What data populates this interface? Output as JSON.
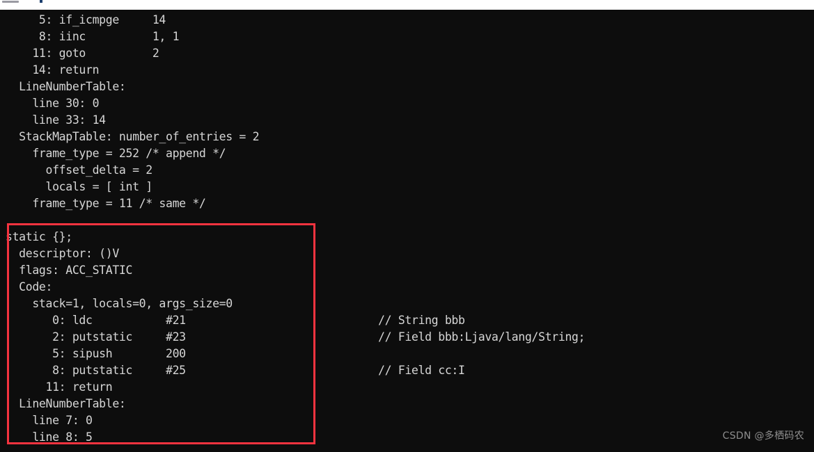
{
  "window": {
    "top_strip": {
      "menu_glyph": "menu-bar",
      "accent_mark": "accent-mark"
    }
  },
  "terminal": {
    "background_color": "#0d0d0d",
    "text_color": "#d6d6d6",
    "code_lines": [
      "     5: if_icmpge     14",
      "     8: iinc          1, 1",
      "    11: goto          2",
      "    14: return",
      "  LineNumberTable:",
      "    line 30: 0",
      "    line 33: 14",
      "  StackMapTable: number_of_entries = 2",
      "    frame_type = 252 /* append */",
      "      offset_delta = 2",
      "      locals = [ int ]",
      "    frame_type = 11 /* same */",
      "",
      "static {};",
      "  descriptor: ()V",
      "  flags: ACC_STATIC",
      "  Code:",
      "    stack=1, locals=0, args_size=0",
      "       0: ldc           #21",
      "       2: putstatic     #23",
      "       5: sipush        200",
      "       8: putstatic     #25",
      "      11: return",
      "  LineNumberTable:",
      "    line 7: 0",
      "    line 8: 5"
    ],
    "comment_lines": [
      "",
      "",
      "",
      "",
      "",
      "",
      "",
      "",
      "",
      "",
      "",
      "",
      "",
      "",
      "",
      "",
      "",
      "",
      "// String bbb",
      "// Field bbb:Ljava/lang/String;",
      "",
      "// Field cc:I",
      "",
      "",
      "",
      ""
    ]
  },
  "annotation": {
    "highlight_box_color": "#f5333f",
    "highlight_box_label": "static-initializer-highlight"
  },
  "watermark": {
    "text": "CSDN @多栖码农"
  }
}
